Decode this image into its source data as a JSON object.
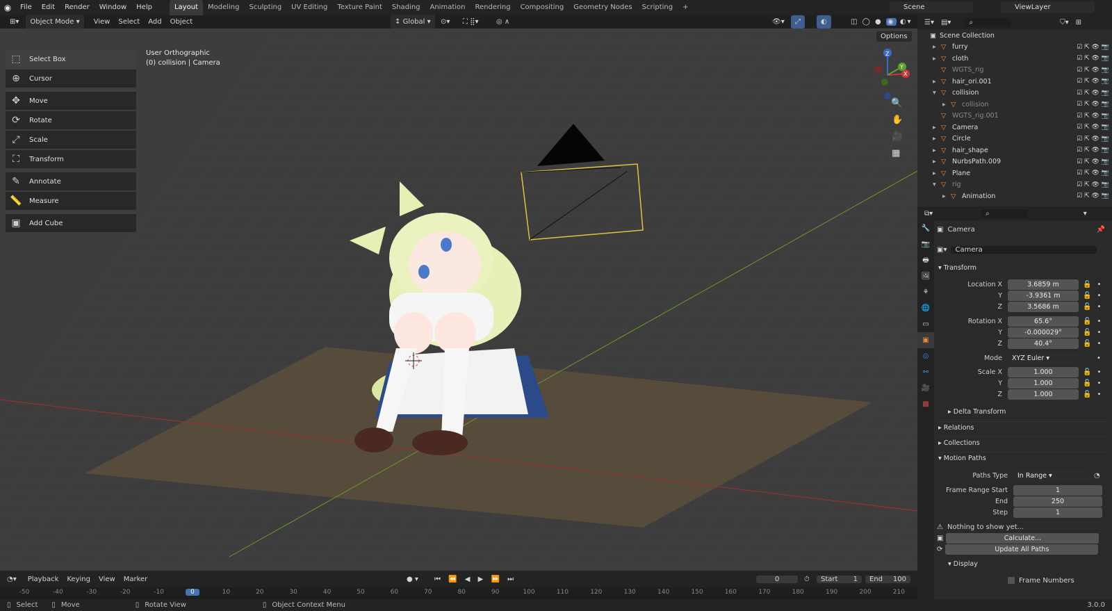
{
  "topbar": {
    "menu": [
      "File",
      "Edit",
      "Render",
      "Window",
      "Help"
    ],
    "workspaces": [
      "Layout",
      "Modeling",
      "Sculpting",
      "UV Editing",
      "Texture Paint",
      "Shading",
      "Animation",
      "Rendering",
      "Compositing",
      "Geometry Nodes",
      "Scripting",
      "+"
    ],
    "scene_name": "Scene",
    "view_layer": "ViewLayer"
  },
  "viewport_header": {
    "mode": "Object Mode",
    "menus": [
      "View",
      "Select",
      "Add",
      "Object"
    ],
    "orientation": "Global",
    "options": "Options"
  },
  "viewport": {
    "view_name": "User Orthographic",
    "object_info": "(0) collision | Camera"
  },
  "tools": [
    {
      "label": "Select Box",
      "icon": "select-box-icon"
    },
    {
      "label": "Cursor",
      "icon": "cursor-icon"
    },
    {
      "label": "Move",
      "icon": "move-icon"
    },
    {
      "label": "Rotate",
      "icon": "rotate-icon"
    },
    {
      "label": "Scale",
      "icon": "scale-icon"
    },
    {
      "label": "Transform",
      "icon": "transform-icon"
    },
    {
      "label": "Annotate",
      "icon": "annotate-icon"
    },
    {
      "label": "Measure",
      "icon": "measure-icon"
    },
    {
      "label": "Add Cube",
      "icon": "add-cube-icon"
    }
  ],
  "outliner": {
    "root": "Scene Collection",
    "items": [
      {
        "name": "furry",
        "dim": false,
        "indent": 1,
        "expand": "▸"
      },
      {
        "name": "cloth",
        "dim": false,
        "indent": 1,
        "expand": "▸"
      },
      {
        "name": "WGTS_rig",
        "dim": true,
        "indent": 1,
        "expand": ""
      },
      {
        "name": "hair_ori.001",
        "dim": false,
        "indent": 1,
        "expand": "▸"
      },
      {
        "name": "collision",
        "dim": false,
        "indent": 1,
        "expand": "▾"
      },
      {
        "name": "collision",
        "dim": true,
        "indent": 2,
        "expand": "▸"
      },
      {
        "name": "WGTS_rig.001",
        "dim": true,
        "indent": 1,
        "expand": ""
      },
      {
        "name": "Camera",
        "dim": false,
        "indent": 1,
        "expand": "▸"
      },
      {
        "name": "Circle",
        "dim": false,
        "indent": 1,
        "expand": "▸"
      },
      {
        "name": "hair_shape",
        "dim": false,
        "indent": 1,
        "expand": "▸"
      },
      {
        "name": "NurbsPath.009",
        "dim": false,
        "indent": 1,
        "expand": "▸"
      },
      {
        "name": "Plane",
        "dim": false,
        "indent": 1,
        "expand": "▸"
      },
      {
        "name": "rig",
        "dim": true,
        "indent": 1,
        "expand": "▾"
      },
      {
        "name": "Animation",
        "dim": false,
        "indent": 2,
        "expand": "▸"
      }
    ]
  },
  "properties": {
    "object_name": "Camera",
    "data_name": "Camera",
    "transform_title": "Transform",
    "location_label": "Location X",
    "location": [
      "3.6859 m",
      "-3.9361 m",
      "3.5686 m"
    ],
    "rotation_label": "Rotation X",
    "rotation": [
      "65.6°",
      "-0.000029°",
      "40.4°"
    ],
    "mode_label": "Mode",
    "mode": "XYZ Euler",
    "scale_label": "Scale X",
    "scale": [
      "1.000",
      "1.000",
      "1.000"
    ],
    "axis_y": "Y",
    "axis_z": "Z",
    "delta": "Delta Transform",
    "relations": "Relations",
    "collections": "Collections",
    "motion_paths": "Motion Paths",
    "paths_type_label": "Paths Type",
    "paths_type": "In Range",
    "frame_start_label": "Frame Range Start",
    "frame_start": "1",
    "end_label": "End",
    "end": "250",
    "step_label": "Step",
    "step": "1",
    "nothing": "Nothing to show yet...",
    "calculate": "Calculate...",
    "update": "Update All Paths",
    "display": "Display",
    "frame_numbers": "Frame Numbers"
  },
  "timeline": {
    "menus": [
      "Playback",
      "Keying",
      "View",
      "Marker"
    ],
    "current_frame": "0",
    "start_label": "Start",
    "start": "1",
    "end_label": "End",
    "end": "100",
    "ruler": [
      "-50",
      "-40",
      "-30",
      "-20",
      "-10",
      "0",
      "10",
      "20",
      "30",
      "40",
      "50",
      "60",
      "70",
      "80",
      "90",
      "100",
      "110",
      "120",
      "130",
      "140",
      "150",
      "160",
      "170",
      "180",
      "190",
      "200",
      "210"
    ]
  },
  "statusbar": {
    "items": [
      "Select",
      "Move",
      "Rotate View",
      "Object Context Menu"
    ],
    "version": "3.0.0"
  },
  "colors": {
    "accent": "#4772b3",
    "selection": "#e0c440",
    "floor": "#5a4c3c"
  }
}
